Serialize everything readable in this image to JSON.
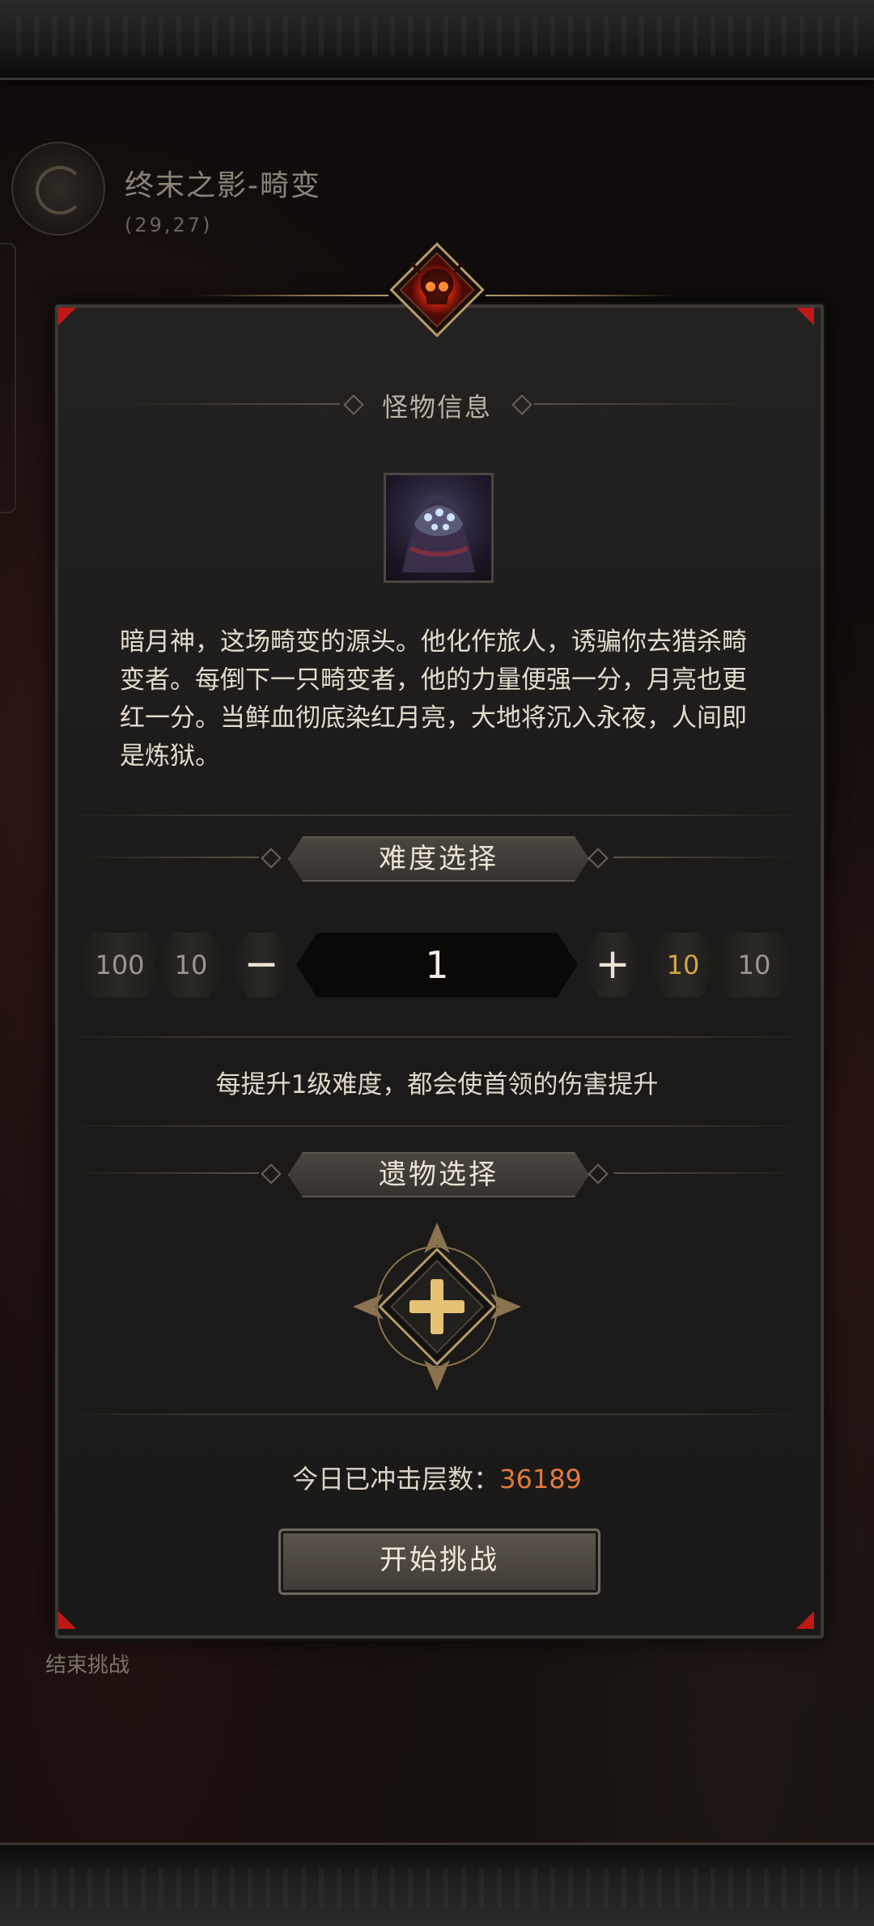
{
  "location": {
    "title": "终末之影-畸变",
    "coordinates": "(29,27)"
  },
  "end_challenge_label": "结束挑战",
  "panel": {
    "monster_section_title": "怪物信息",
    "monster_description": "暗月神，这场畸变的源头。他化作旅人，诱骗你去猎杀畸变者。每倒下一只畸变者，他的力量便强一分，月亮也更红一分。当鲜血彻底染红月亮，大地将沉入永夜，人间即是炼狱。",
    "difficulty": {
      "title": "难度选择",
      "minus_100": "100",
      "minus_10": "10",
      "minus_icon": "−",
      "value": "1",
      "plus_icon": "+",
      "plus_10": "10",
      "plus_10b": "10",
      "hint": "每提升1级难度，都会使首领的伤害提升"
    },
    "relic": {
      "title": "遗物选择",
      "add_icon": "plus-icon"
    },
    "count_label": "今日已冲击层数：",
    "count_value": "36189",
    "start_button": "开始挑战"
  },
  "colors": {
    "accent_orange": "#e47a3a",
    "accent_gold": "#d6a544",
    "corner_red": "#c01818"
  }
}
